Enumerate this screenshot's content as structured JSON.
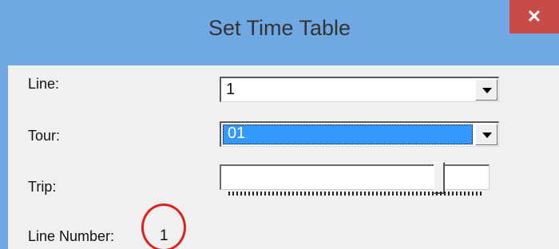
{
  "window": {
    "title": "Set Time Table",
    "close_glyph": "✕"
  },
  "fields": {
    "line": {
      "label": "Line:",
      "value": "1"
    },
    "tour": {
      "label": "Tour:",
      "value": "01"
    },
    "trip": {
      "label": "Trip:",
      "slider_level": 0.8
    },
    "line_number": {
      "label": "Line Number:",
      "value": "1"
    }
  },
  "colors": {
    "titlebar": "#6fa8e2",
    "close": "#c94b47",
    "selection": "#3399ff",
    "highlight_circle": "#e0201c"
  }
}
